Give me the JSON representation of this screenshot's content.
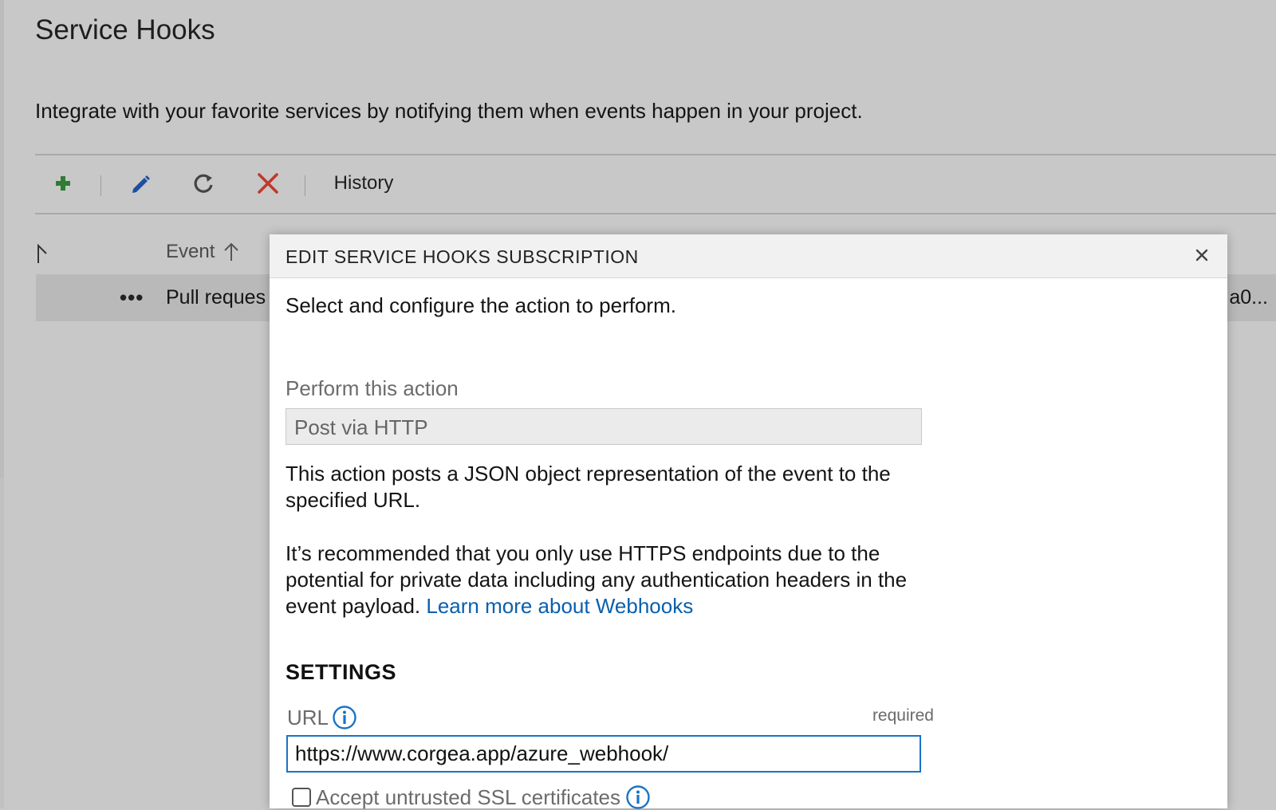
{
  "page": {
    "title": "Service Hooks",
    "description": "Integrate with your favorite services by notifying them when events happen in your project."
  },
  "toolbar": {
    "items": [
      {
        "name": "add",
        "icon": "plus-icon",
        "color": "#2e7d32"
      },
      {
        "name": "edit",
        "icon": "pencil-icon",
        "color": "#1e4fa0"
      },
      {
        "name": "refresh",
        "icon": "refresh-icon",
        "color": "#444444"
      },
      {
        "name": "delete",
        "icon": "x-icon",
        "color": "#c0392b"
      }
    ],
    "history_label": "History"
  },
  "grid": {
    "event_header": "Event",
    "rows": [
      {
        "more": "•••",
        "event": "Pull reques",
        "right_value": "a0..."
      }
    ]
  },
  "dialog": {
    "title": "EDIT SERVICE HOOKS SUBSCRIPTION",
    "intro": "Select and configure the action to perform.",
    "action_label": "Perform this action",
    "action_value": "Post via HTTP",
    "desc_1": "This action posts a JSON object representation of the event to the specified URL.",
    "desc_2_text": "It’s recommended that you only use HTTPS endpoints due to the potential for private data including any authentication headers in the event payload.",
    "desc_2_link": "Learn more about Webhooks",
    "settings_heading": "SETTINGS",
    "url_label": "URL",
    "url_required": "required",
    "url_value": "https://www.corgea.app/azure_webhook/",
    "ssl_label": "Accept untrusted SSL certificates",
    "ssl_checked": false
  },
  "colors": {
    "link": "#0a5fad",
    "focus_border": "#1a73c6",
    "overlay": "#c8c8c8"
  }
}
